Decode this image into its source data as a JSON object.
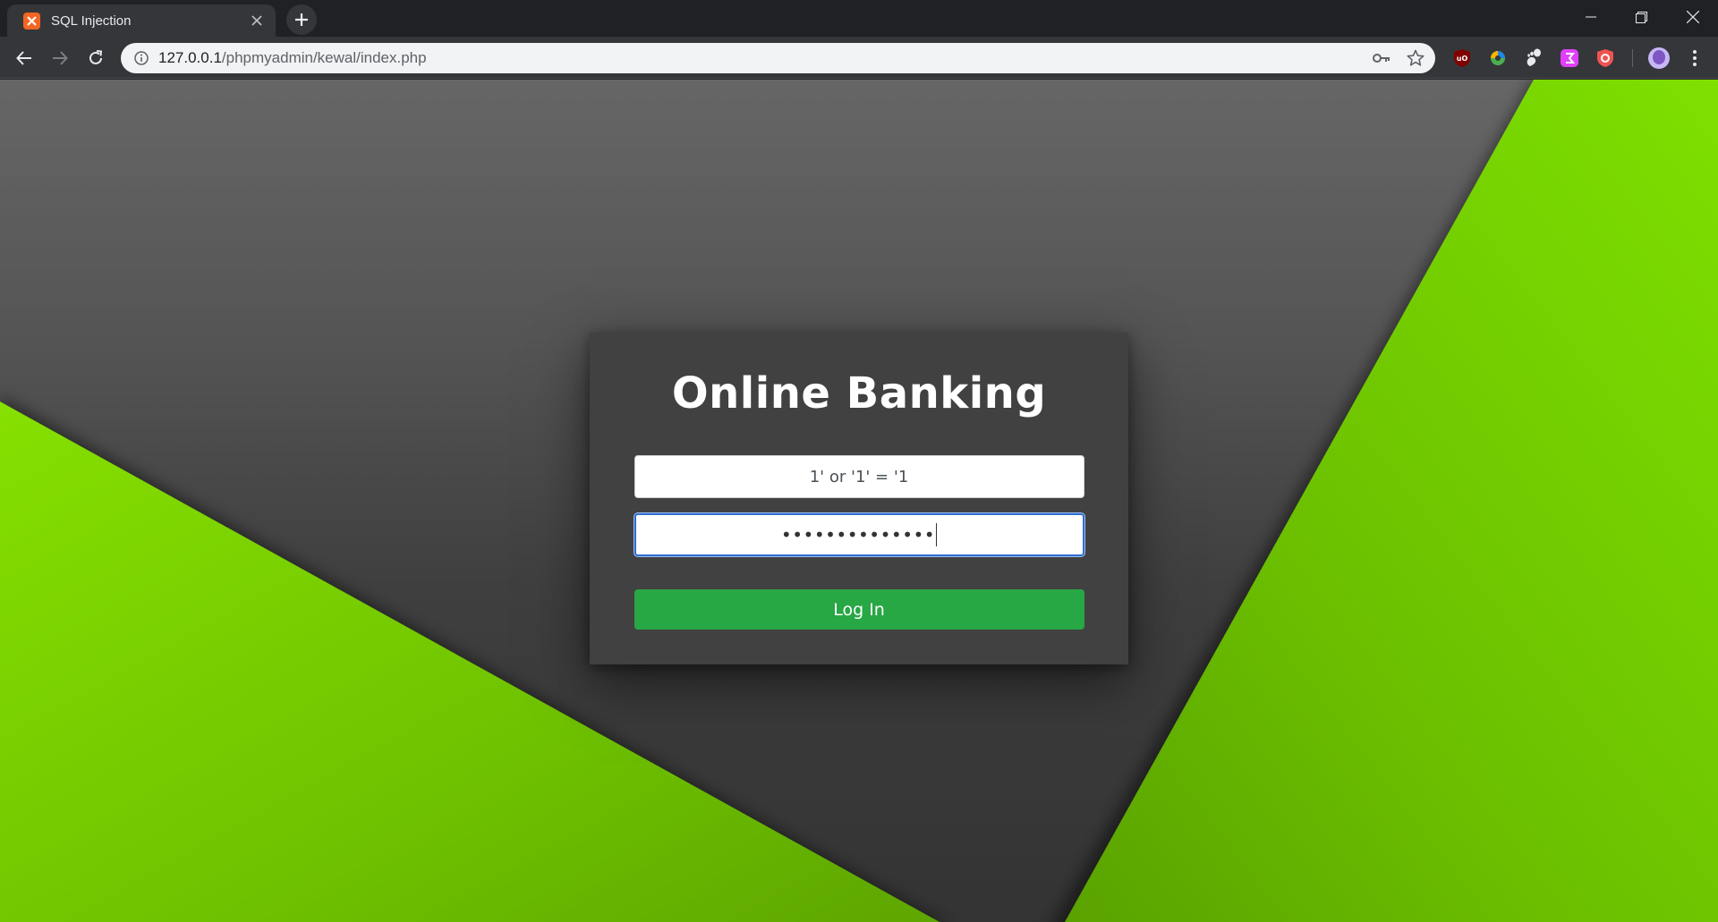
{
  "browser": {
    "tab": {
      "title": "SQL Injection",
      "favicon": "xampp-icon"
    },
    "address": {
      "host": "127.0.0.1",
      "path": "/phpmyadmin/kewal/index.php"
    },
    "extensions": [
      "ublock-origin-icon",
      "color-picker-icon",
      "gnome-icon",
      "figma-icon",
      "privacy-badger-icon",
      "profile-avatar-icon"
    ]
  },
  "page": {
    "heading": "Online Banking",
    "username_value": "1' or '1' = '1",
    "password_mask": "••••••••••••••",
    "login_button": "Log In"
  },
  "colors": {
    "accent_green": "#28a745",
    "background_green": "#7ed400",
    "card": "#414141"
  }
}
